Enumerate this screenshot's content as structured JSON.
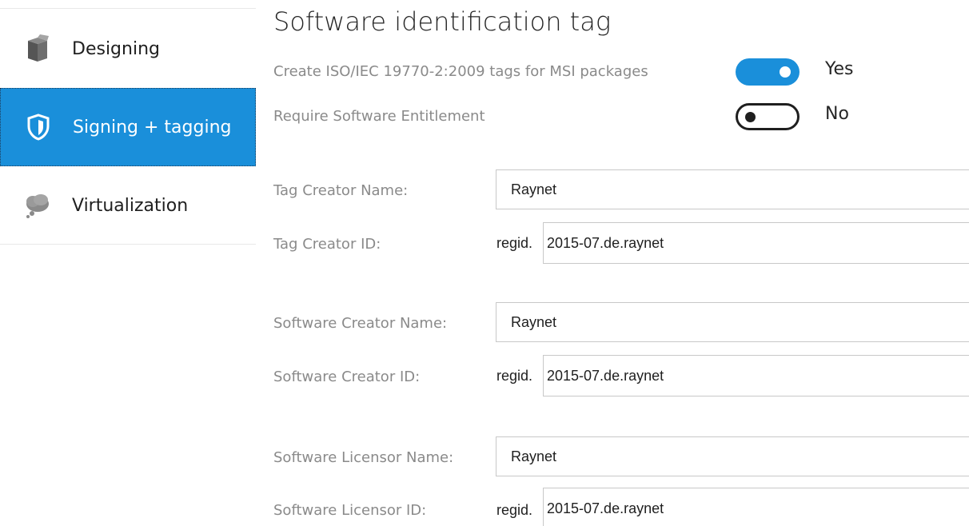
{
  "sidebar": {
    "items": [
      {
        "label": "Designing",
        "icon": "box-icon",
        "selected": false
      },
      {
        "label": "Signing + tagging",
        "icon": "shield-icon",
        "selected": true
      },
      {
        "label": "Virtualization",
        "icon": "cloud-icon",
        "selected": false
      }
    ]
  },
  "main": {
    "title": "Software identification tag",
    "options": [
      {
        "label": "Create ISO/IEC 19770-2:2009 tags for MSI packages",
        "state": true,
        "state_text": "Yes"
      },
      {
        "label": "Require Software Entitlement",
        "state": false,
        "state_text": "No"
      }
    ],
    "fields": {
      "tag_creator_name": {
        "label": "Tag Creator Name:",
        "value": "Raynet"
      },
      "tag_creator_id": {
        "label": "Tag Creator ID:",
        "prefix": "regid.",
        "value": "2015-07.de.raynet"
      },
      "software_creator_name": {
        "label": "Software Creator Name:",
        "value": "Raynet"
      },
      "software_creator_id": {
        "label": "Software Creator ID:",
        "prefix": "regid.",
        "value": "2015-07.de.raynet"
      },
      "software_licensor_name": {
        "label": "Software Licensor Name:",
        "value": "Raynet"
      },
      "software_licensor_id": {
        "label": "Software Licensor ID:",
        "prefix": "regid.",
        "value": "2015-07.de.raynet"
      }
    }
  },
  "colors": {
    "accent": "#1a8fda",
    "label_gray": "#8a8a8a",
    "text_dark": "#1f1f1f"
  }
}
